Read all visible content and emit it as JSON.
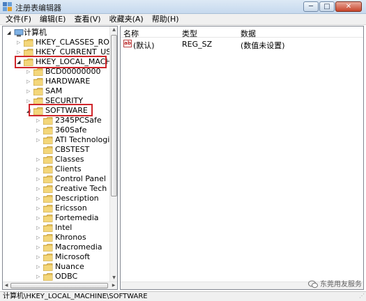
{
  "window": {
    "title": "注册表编辑器",
    "buttons": [
      "─",
      "□",
      "✕"
    ]
  },
  "menu": [
    "文件(F)",
    "编辑(E)",
    "查看(V)",
    "收藏夹(A)",
    "帮助(H)"
  ],
  "tree": {
    "root": "计算机",
    "hives": [
      "HKEY_CLASSES_ROOT",
      "HKEY_CURRENT_USER",
      "HKEY_LOCAL_MACHINE"
    ],
    "hklm_children": [
      "BCD00000000",
      "HARDWARE",
      "SAM",
      "SECURITY",
      "SOFTWARE"
    ],
    "software_children": [
      "2345PCSafe",
      "360Safe",
      "ATI Technologies",
      "CBSTEST",
      "Classes",
      "Clients",
      "Control Panel",
      "Creative Tech",
      "Description",
      "Ericsson",
      "Fortemedia",
      "Intel",
      "Khronos",
      "Macromedia",
      "Microsoft",
      "Nuance",
      "ODBC"
    ]
  },
  "values": {
    "headers": {
      "name": "名称",
      "type": "类型",
      "data": "数据"
    },
    "rows": [
      {
        "icon": "ab",
        "name": "(默认)",
        "type": "REG_SZ",
        "data": "(数值未设置)"
      }
    ]
  },
  "watermark": "东莞用友服务",
  "status": "计算机\\HKEY_LOCAL_MACHINE\\SOFTWARE",
  "colors": {
    "highlight": "#d0262b",
    "folder": "#e8c25a",
    "titlebar": "#c6d9ee"
  }
}
